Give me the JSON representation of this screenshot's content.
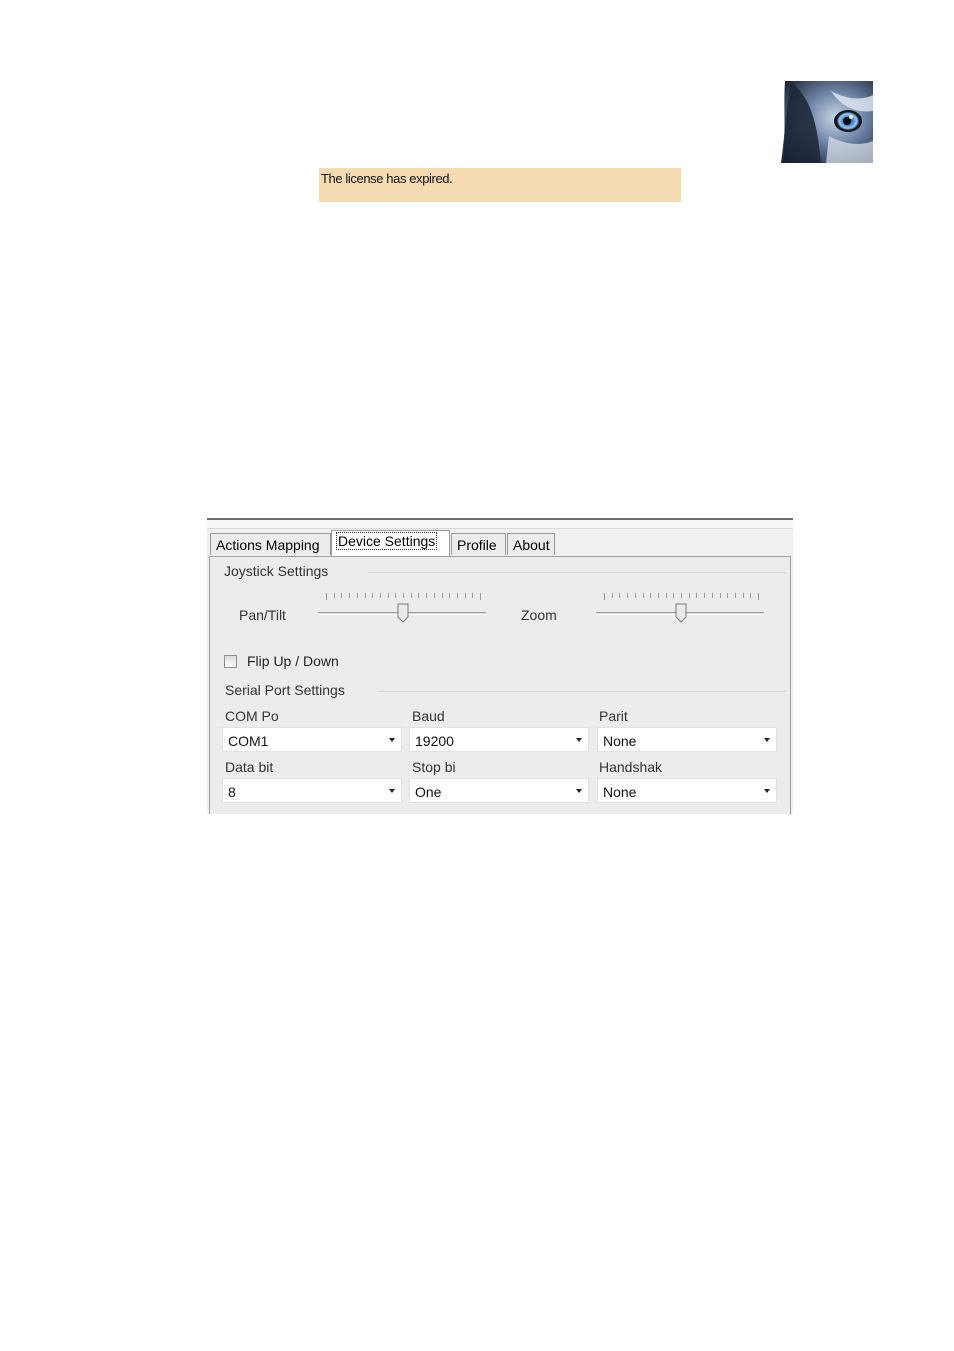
{
  "banner": {
    "text": "The license has expired."
  },
  "tabs": [
    {
      "label": "Actions Mapping"
    },
    {
      "label": "Device Settings"
    },
    {
      "label": "Profile"
    },
    {
      "label": "About"
    }
  ],
  "joystick": {
    "title": "Joystick Settings",
    "pan_tilt": {
      "label": "Pan/Tilt",
      "value_fraction": 0.5
    },
    "zoom": {
      "label": "Zoom",
      "value_fraction": 0.5
    },
    "flip_label": "Flip Up / Down",
    "flip_checked": false
  },
  "serial": {
    "title": "Serial Port Settings",
    "com_port": {
      "label": "COM Po",
      "value": "COM1"
    },
    "baud": {
      "label": "Baud",
      "value": "19200"
    },
    "parity": {
      "label": "Parit",
      "value": "None"
    },
    "data_bits": {
      "label": "Data bit",
      "value": "8"
    },
    "stop_bits": {
      "label": "Stop  bi",
      "value": "One"
    },
    "handshake": {
      "label": "Handshak",
      "value": "None"
    }
  },
  "icons": {
    "logo": "wolf-eye-logo",
    "dropdown": "chevron-down-icon",
    "slider_thumb": "slider-thumb-icon"
  },
  "colors": {
    "banner": "#f4dbb2",
    "panel": "#ececec"
  }
}
